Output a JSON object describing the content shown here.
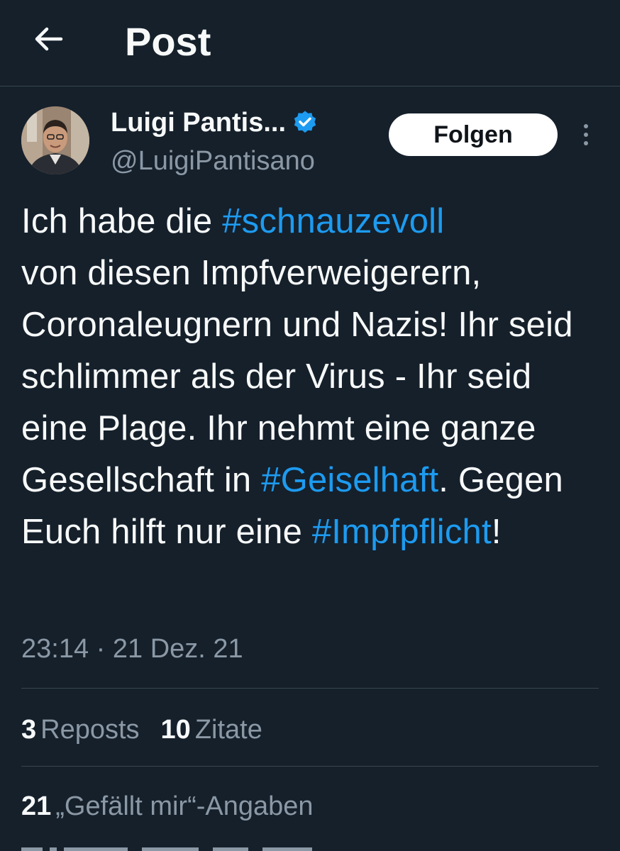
{
  "header": {
    "back_icon": "arrow-left-icon",
    "title": "Post"
  },
  "author": {
    "display_name": "Luigi Pantis...",
    "verified_icon": "verified-badge-icon",
    "handle": "@LuigiPantisano",
    "follow_label": "Folgen",
    "more_icon": "more-vertical-icon"
  },
  "tweet": {
    "segments": [
      {
        "text": "Ich habe die ",
        "type": "text"
      },
      {
        "text": "#schnauzevoll",
        "type": "hashtag"
      },
      {
        "text": " von diesen Impfverweigerern, Coronaleugnern und Nazis! Ihr seid schlimmer als der Virus - Ihr seid eine Plage. Ihr nehmt eine ganze Gesellschaft in ",
        "type": "text"
      },
      {
        "text": "#Geiselhaft",
        "type": "hashtag"
      },
      {
        "text": ". Gegen Euch hilft nur eine ",
        "type": "text"
      },
      {
        "text": "#Impfpflicht",
        "type": "hashtag"
      },
      {
        "text": "!",
        "type": "text"
      }
    ],
    "time": "23:14",
    "separator": " · ",
    "date": "21 Dez. 21"
  },
  "stats": {
    "reposts_count": "3",
    "reposts_label": "Reposts",
    "quotes_count": "10",
    "quotes_label": "Zitate",
    "likes_count": "21",
    "likes_label": "„Gefällt mir“-Angaben"
  },
  "colors": {
    "background": "#15202b",
    "accent": "#1d9bf0",
    "text_primary": "#f7f9f9",
    "text_secondary": "#8b98a5",
    "divider": "#38444d"
  }
}
